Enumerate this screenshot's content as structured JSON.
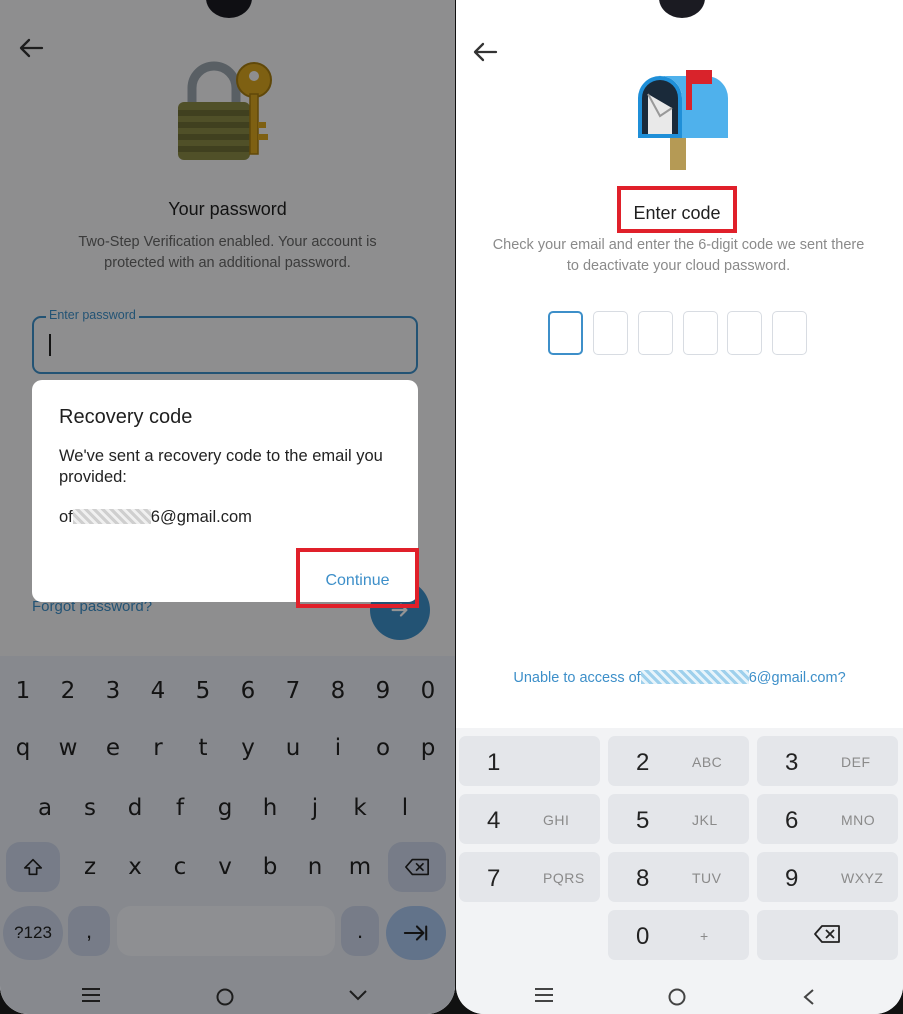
{
  "left_screen": {
    "title": "Your password",
    "subtitle": "Two-Step Verification enabled. Your account is protected with an additional password.",
    "password_field": {
      "label": "Enter password",
      "value": ""
    },
    "forgot_link": "Forgot password?",
    "keyboard": {
      "row1": [
        "1",
        "2",
        "3",
        "4",
        "5",
        "6",
        "7",
        "8",
        "9",
        "0"
      ],
      "row2": [
        "q",
        "w",
        "e",
        "r",
        "t",
        "y",
        "u",
        "i",
        "o",
        "p"
      ],
      "row3": [
        "a",
        "s",
        "d",
        "f",
        "g",
        "h",
        "j",
        "k",
        "l"
      ],
      "row4": [
        "z",
        "x",
        "c",
        "v",
        "b",
        "n",
        "m"
      ],
      "symbols_key": "?123",
      "comma_key": ",",
      "period_key": "."
    },
    "dialog": {
      "title": "Recovery code",
      "message": "We've sent a recovery code to the email you provided:",
      "email_prefix": "of",
      "email_suffix": "6@gmail.com",
      "continue_label": "Continue"
    }
  },
  "right_screen": {
    "title": "Enter code",
    "subtitle": "Check your email and enter the 6-digit code we sent there to deactivate your cloud password.",
    "code_cells": [
      "",
      "",
      "",
      "",
      "",
      ""
    ],
    "unable_prefix": "Unable to access of",
    "unable_suffix": "6@gmail.com?",
    "numpad": [
      {
        "digit": "1",
        "letters": ""
      },
      {
        "digit": "2",
        "letters": "ABC"
      },
      {
        "digit": "3",
        "letters": "DEF"
      },
      {
        "digit": "4",
        "letters": "GHI"
      },
      {
        "digit": "5",
        "letters": "JKL"
      },
      {
        "digit": "6",
        "letters": "MNO"
      },
      {
        "digit": "7",
        "letters": "PQRS"
      },
      {
        "digit": "8",
        "letters": "TUV"
      },
      {
        "digit": "9",
        "letters": "WXYZ"
      },
      {
        "digit": "0",
        "letters": "+"
      }
    ]
  },
  "colors": {
    "accent": "#3d8fc9",
    "highlight": "#e0202a"
  }
}
